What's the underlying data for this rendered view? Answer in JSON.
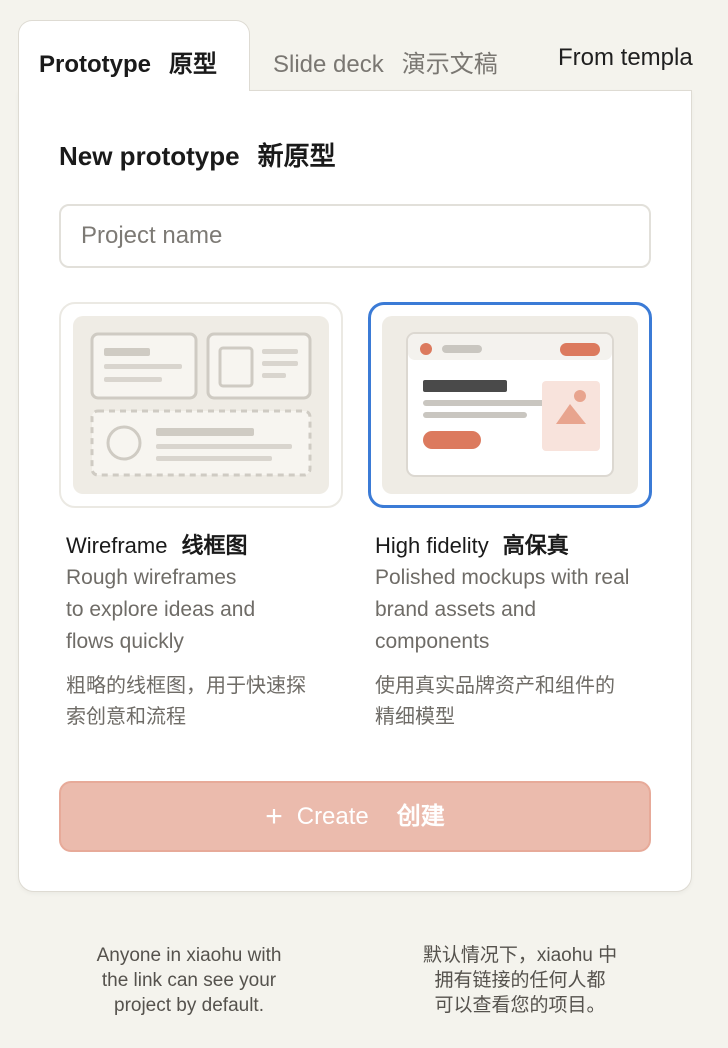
{
  "tabs": [
    {
      "label_en": "Prototype",
      "label_cn": "原型",
      "active": true
    },
    {
      "label_en": "Slide deck",
      "label_cn": "演示文稿",
      "active": false
    },
    {
      "label_en": "From templa",
      "label_cn": "",
      "active": false
    }
  ],
  "panel": {
    "title_en": "New prototype",
    "title_cn": "新原型",
    "project_name_placeholder": "Project name"
  },
  "options": [
    {
      "title_en": "Wireframe",
      "title_cn": "线框图",
      "desc_en_lines": [
        "Rough wireframes",
        "to explore ideas and",
        "flows quickly"
      ],
      "desc_cn_lines": [
        "粗略的线框图，用于快速探",
        "索创意和流程"
      ],
      "selected": false,
      "icon": "wireframe-thumbnail-icon"
    },
    {
      "title_en": "High fidelity",
      "title_cn": "高保真",
      "desc_en_lines": [
        "Polished mockups with real",
        "brand assets and",
        "components"
      ],
      "desc_cn_lines": [
        "使用真实品牌资产和组件的",
        "精细模型"
      ],
      "selected": true,
      "icon": "high-fidelity-thumbnail-icon"
    }
  ],
  "create_button": {
    "icon": "plus-icon",
    "plus": "+",
    "label_en": "Create",
    "label_cn": "创建"
  },
  "footer": {
    "en_lines": [
      "Anyone in xiaohu with",
      "the link can see your",
      "project by default."
    ],
    "cn_lines": [
      "默认情况下，xiaohu 中",
      "拥有链接的任何人都",
      "可以查看您的项目。"
    ]
  },
  "colors": {
    "accent": "#dc7a5e",
    "accent_disabled": "#ebbbad",
    "selection_border": "#3b7bd6",
    "background": "#f4f3ed"
  }
}
